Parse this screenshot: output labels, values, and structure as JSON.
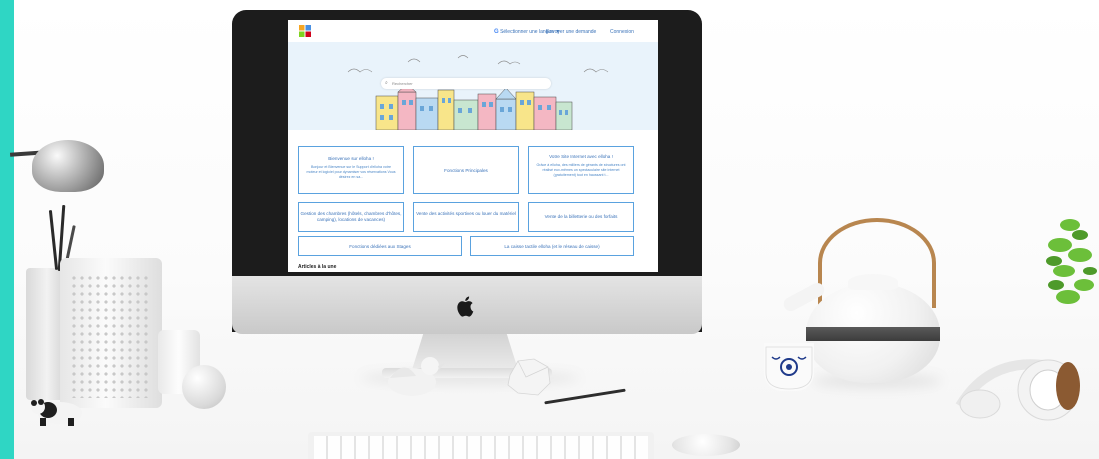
{
  "site": {
    "header": {
      "language_label": "Sélectionner une langue",
      "language_g": "G",
      "language_caret": "▼",
      "submit_request": "Envoyer une demande",
      "login": "Connexion"
    },
    "search": {
      "placeholder": "Rechercher",
      "icon": "search-icon"
    },
    "cards": [
      {
        "title": "Bienvenue sur elloha !",
        "desc": "Bonjour et Bienvenue sur le Support d'elloha votre moteur et logiciel pour dynamiser vos réservations Vous désirez en sa..."
      },
      {
        "title": "Fonctions Principales",
        "desc": ""
      },
      {
        "title": "Votre Site Internet avec elloha !",
        "desc": "Grâce à elloha, des milliers de gérants de structures ont réalisé eux-mêmes un spectaculaire site internet (gratuitement) tout en haussant t..."
      },
      {
        "title": "Gestion des chambres (hôtels, chambres d'hôtes, camping), locations de vacances)",
        "desc": ""
      },
      {
        "title": "Vente des activités sportives ou louer du matériel",
        "desc": ""
      },
      {
        "title": "Vente de la billetterie ou des forfaits",
        "desc": ""
      },
      {
        "title": "Fonctions dédiées aux Stages",
        "desc": ""
      },
      {
        "title": "La caisse tactile elloha (et le réseau de caisse)",
        "desc": ""
      }
    ],
    "articles_heading": "Articles à la une"
  },
  "colors": {
    "accent": "#3b73b9",
    "card_border": "#5aa2df",
    "hero_bg": "#e9f3fb",
    "teal_strip": "#2fd6c4"
  }
}
